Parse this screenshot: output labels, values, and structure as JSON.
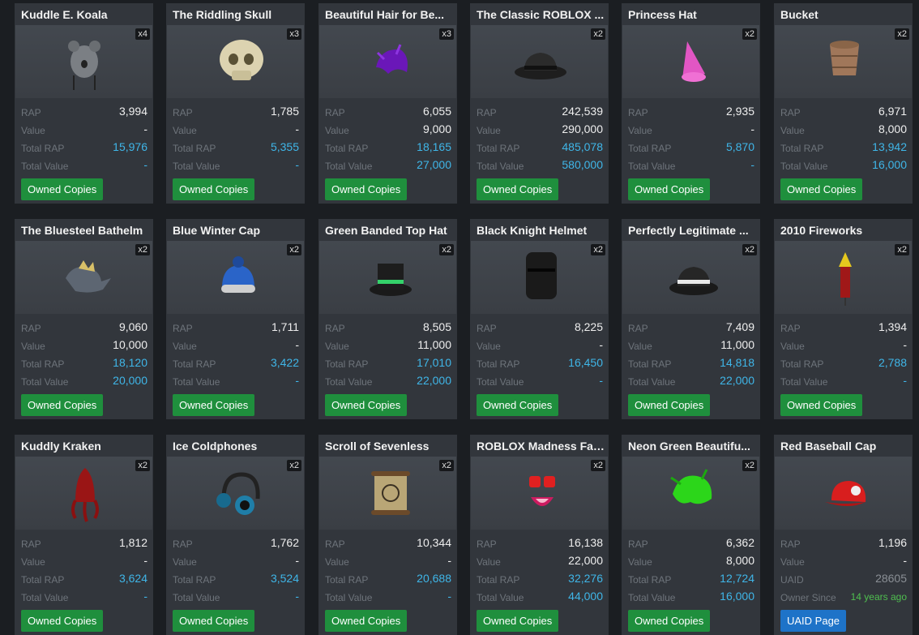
{
  "labels": {
    "rap": "RAP",
    "value": "Value",
    "total_rap": "Total RAP",
    "total_value": "Total Value",
    "owned_copies": "Owned Copies"
  },
  "items": [
    {
      "name": "Kuddle E. Koala",
      "count": "x4",
      "rap": "3,994",
      "value": "-",
      "total_rap": "15,976",
      "total_value": "-",
      "icon": "koala-hat-icon"
    },
    {
      "name": "The Riddling Skull",
      "count": "x3",
      "rap": "1,785",
      "value": "-",
      "total_rap": "5,355",
      "total_value": "-",
      "icon": "skull-icon"
    },
    {
      "name": "Beautiful Hair for Be...",
      "count": "x3",
      "rap": "6,055",
      "value": "9,000",
      "total_rap": "18,165",
      "total_value": "27,000",
      "icon": "purple-hair-icon"
    },
    {
      "name": "The Classic ROBLOX ...",
      "count": "x2",
      "rap": "242,539",
      "value": "290,000",
      "total_rap": "485,078",
      "total_value": "580,000",
      "icon": "fedora-icon"
    },
    {
      "name": "Princess Hat",
      "count": "x2",
      "rap": "2,935",
      "value": "-",
      "total_rap": "5,870",
      "total_value": "-",
      "icon": "princess-hat-icon"
    },
    {
      "name": "Bucket",
      "count": "x2",
      "rap": "6,971",
      "value": "8,000",
      "total_rap": "13,942",
      "total_value": "16,000",
      "icon": "bucket-icon"
    },
    {
      "name": "The Bluesteel Bathelm",
      "count": "x2",
      "rap": "9,060",
      "value": "10,000",
      "total_rap": "18,120",
      "total_value": "20,000",
      "icon": "bathelm-icon"
    },
    {
      "name": "Blue Winter Cap",
      "count": "x2",
      "rap": "1,711",
      "value": "-",
      "total_rap": "3,422",
      "total_value": "-",
      "icon": "winter-cap-icon"
    },
    {
      "name": "Green Banded Top Hat",
      "count": "x2",
      "rap": "8,505",
      "value": "11,000",
      "total_rap": "17,010",
      "total_value": "22,000",
      "icon": "top-hat-icon"
    },
    {
      "name": "Black Knight Helmet",
      "count": "x2",
      "rap": "8,225",
      "value": "-",
      "total_rap": "16,450",
      "total_value": "-",
      "icon": "knight-helmet-icon"
    },
    {
      "name": "Perfectly Legitimate ...",
      "count": "x2",
      "rap": "7,409",
      "value": "11,000",
      "total_rap": "14,818",
      "total_value": "22,000",
      "icon": "striped-fedora-icon"
    },
    {
      "name": "2010 Fireworks",
      "count": "x2",
      "rap": "1,394",
      "value": "-",
      "total_rap": "2,788",
      "total_value": "-",
      "icon": "firework-rocket-icon"
    },
    {
      "name": "Kuddly Kraken",
      "count": "x2",
      "rap": "1,812",
      "value": "-",
      "total_rap": "3,624",
      "total_value": "-",
      "icon": "kraken-hat-icon"
    },
    {
      "name": "Ice Coldphones",
      "count": "x2",
      "rap": "1,762",
      "value": "-",
      "total_rap": "3,524",
      "total_value": "-",
      "icon": "headphones-icon"
    },
    {
      "name": "Scroll of Sevenless",
      "count": "x2",
      "rap": "10,344",
      "value": "-",
      "total_rap": "20,688",
      "total_value": "-",
      "icon": "scroll-icon"
    },
    {
      "name": "ROBLOX Madness Face",
      "count": "x2",
      "rap": "16,138",
      "value": "22,000",
      "total_rap": "32,276",
      "total_value": "44,000",
      "icon": "madness-face-icon"
    },
    {
      "name": "Neon Green Beautifu...",
      "count": "x2",
      "rap": "6,362",
      "value": "8,000",
      "total_rap": "12,724",
      "total_value": "16,000",
      "icon": "green-hair-icon"
    },
    {
      "name": "Red Baseball Cap",
      "count": "",
      "rap": "1,196",
      "value": "-",
      "uaid_label": "UAID",
      "uaid": "28605",
      "owner_since_label": "Owner Since",
      "owner_since": "14 years ago",
      "button": "UAID Page",
      "icon": "baseball-cap-icon"
    }
  ],
  "colors": {
    "page_bg": "#1b1e22",
    "card_bg": "#32363c",
    "accent_blue": "#3fb6e8",
    "button_green": "#1f8f3d",
    "button_blue": "#1e73c8"
  }
}
